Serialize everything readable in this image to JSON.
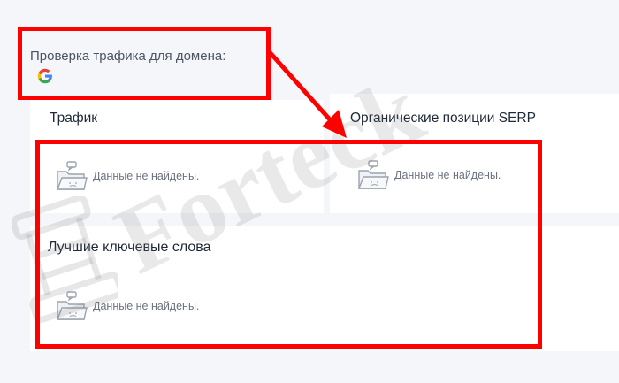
{
  "header": {
    "title": "Проверка трафика для домена:",
    "search_engine_icon": "google-logo-icon"
  },
  "cards": {
    "traffic": {
      "title": "Трафик",
      "empty_text": "Данные не найдены."
    },
    "serp": {
      "title": "Органические позиции SERP",
      "empty_text": "Данные не найдены."
    },
    "keywords": {
      "title": "Лучшие ключевые слова",
      "empty_text": "Данные не найдены."
    }
  },
  "empty_icon": "empty-folder-icon",
  "annotation": {
    "highlight_color": "#ff0000"
  },
  "watermark": {
    "text": "Forteck"
  },
  "colors": {
    "background": "#f4f6f9",
    "card": "#ffffff",
    "title": "#1f2937",
    "muted": "#6b7280"
  }
}
